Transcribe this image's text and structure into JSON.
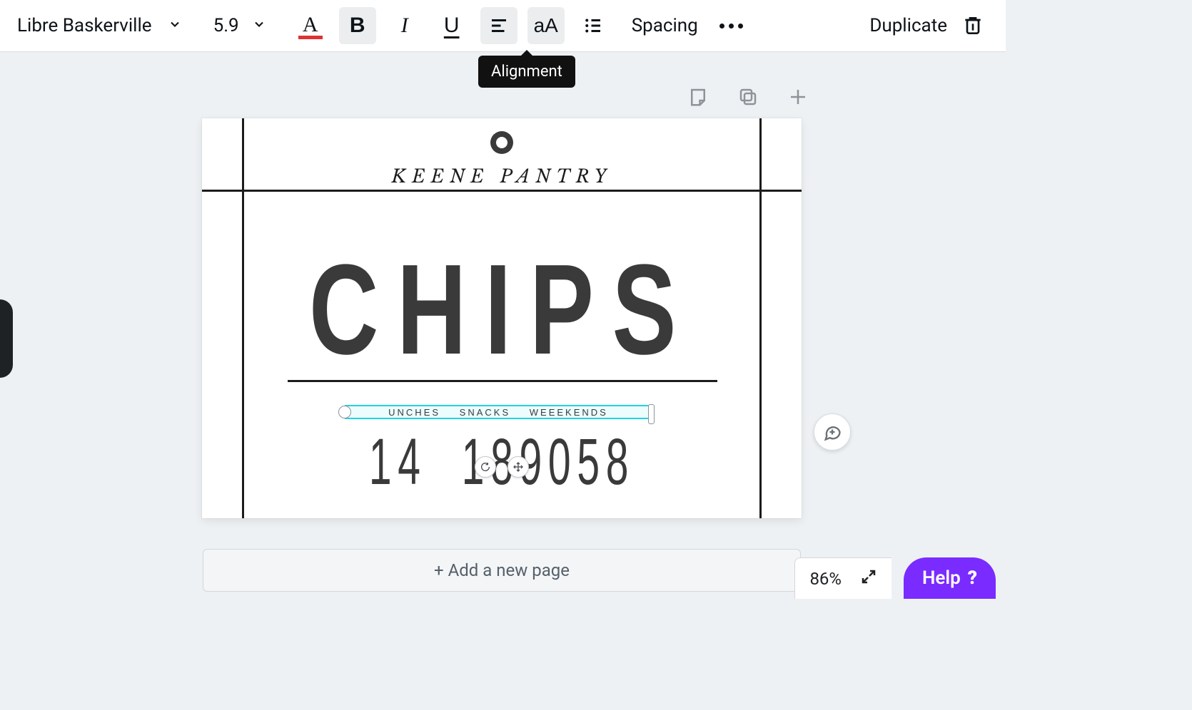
{
  "toolbar": {
    "font_name": "Libre Baskerville",
    "font_size": "5.9",
    "spacing_label": "Spacing",
    "duplicate_label": "Duplicate",
    "case_label": "aA",
    "tooltip": "Alignment"
  },
  "canvas": {
    "brand": "KEENE PANTRY",
    "title": "CHIPS",
    "tags": [
      "UNCHES",
      "SNACKS",
      "WEEEKENDS"
    ],
    "number_a": "14",
    "number_b": "189058"
  },
  "footer": {
    "add_page_label": "+ Add a new page",
    "zoom": "86%",
    "help_label": "Help"
  }
}
